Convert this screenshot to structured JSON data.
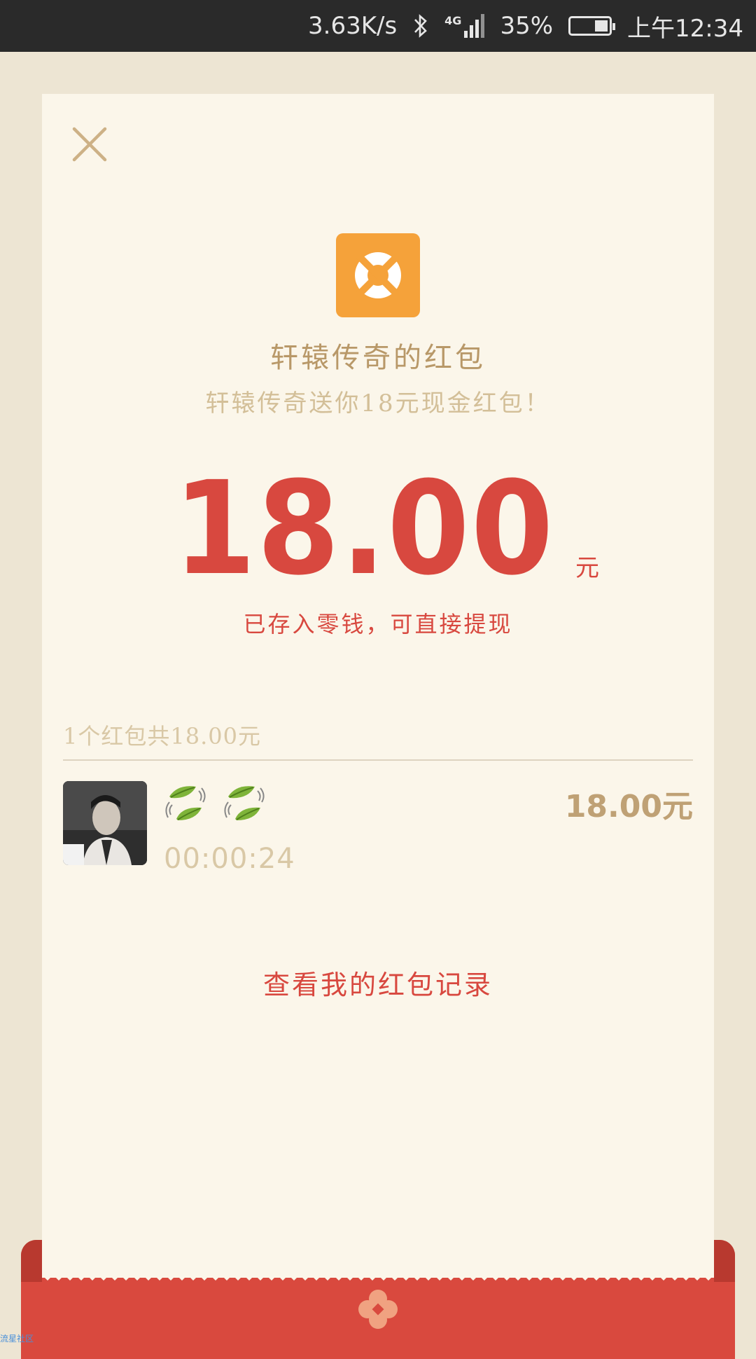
{
  "status_bar": {
    "net_speed": "3.63K/s",
    "network_type": "4G",
    "battery_percent": "35%",
    "battery_level": 0.35,
    "time": "上午12:34",
    "icons": [
      "bluetooth-icon",
      "signal-4g-icon",
      "battery-icon"
    ]
  },
  "packet": {
    "sender_title": "轩辕传奇的红包",
    "greeting": "轩辕传奇送你18元现金红包！",
    "amount": "18.00",
    "unit": "元",
    "deposit_note": "已存入零钱，可直接提现"
  },
  "records": {
    "summary": "1个红包共18.00元",
    "items": [
      {
        "name_icons": [
          "leaf-emoji-icon",
          "leaf-emoji-icon"
        ],
        "time": "00:00:24",
        "amount": "18.00元"
      }
    ]
  },
  "history_link": "查看我的红包记录",
  "watermark": "流星社区",
  "colors": {
    "accent_red": "#d8483f",
    "gold_text": "#b89868",
    "card_bg": "#fbf6ea",
    "page_bg": "#ede5d3",
    "logo_orange": "#f5a23a"
  }
}
